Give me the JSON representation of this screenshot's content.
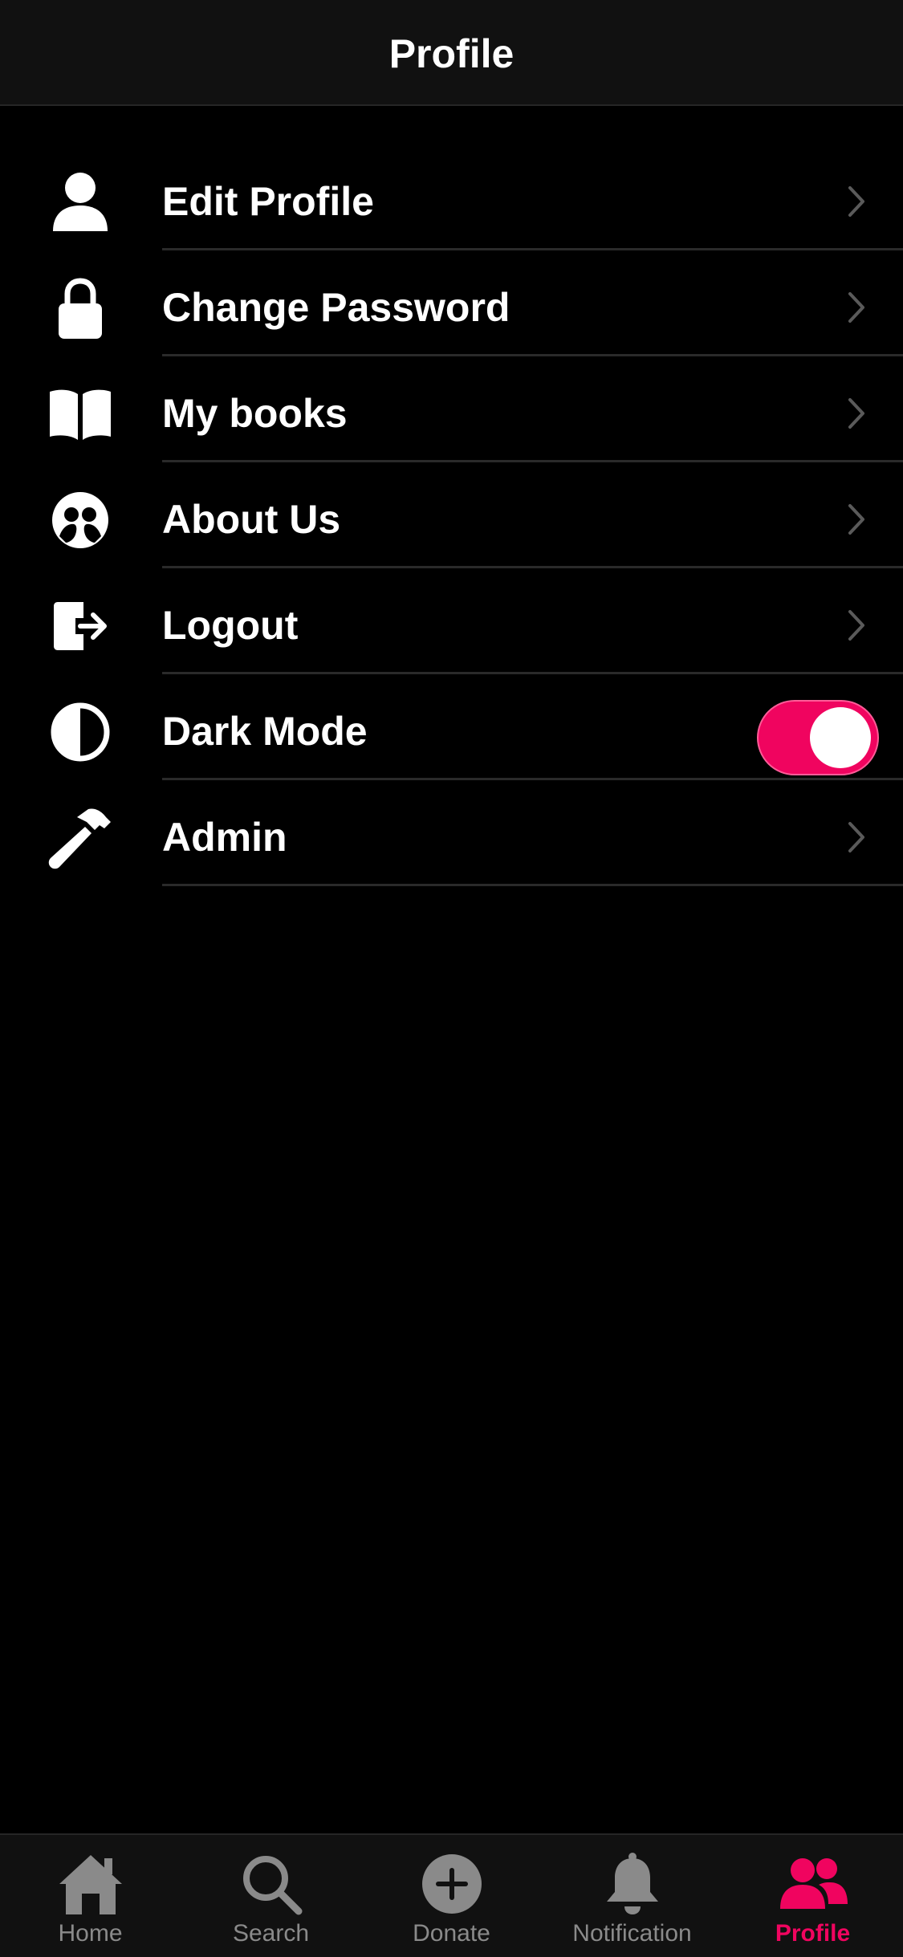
{
  "header": {
    "title": "Profile"
  },
  "menu": {
    "items": [
      {
        "label": "Edit Profile",
        "icon": "user-icon"
      },
      {
        "label": "Change Password",
        "icon": "lock-icon"
      },
      {
        "label": "My books",
        "icon": "book-open-icon"
      },
      {
        "label": "About Us",
        "icon": "about-icon"
      },
      {
        "label": "Logout",
        "icon": "logout-icon"
      },
      {
        "label": "Dark Mode",
        "icon": "contrast-icon",
        "toggle": true
      },
      {
        "label": "Admin",
        "icon": "hammer-icon"
      }
    ],
    "dark_mode_enabled": true
  },
  "tabbar": {
    "tabs": [
      {
        "label": "Home",
        "icon": "home-icon"
      },
      {
        "label": "Search",
        "icon": "search-icon"
      },
      {
        "label": "Donate",
        "icon": "plus-circle-icon"
      },
      {
        "label": "Notification",
        "icon": "bell-icon"
      },
      {
        "label": "Profile",
        "icon": "users-icon",
        "active": true
      }
    ]
  },
  "colors": {
    "accent": "#f0045f",
    "background": "#000000",
    "bar": "#111111",
    "inactive": "#8a8a8a",
    "divider": "#2a2a2a"
  }
}
